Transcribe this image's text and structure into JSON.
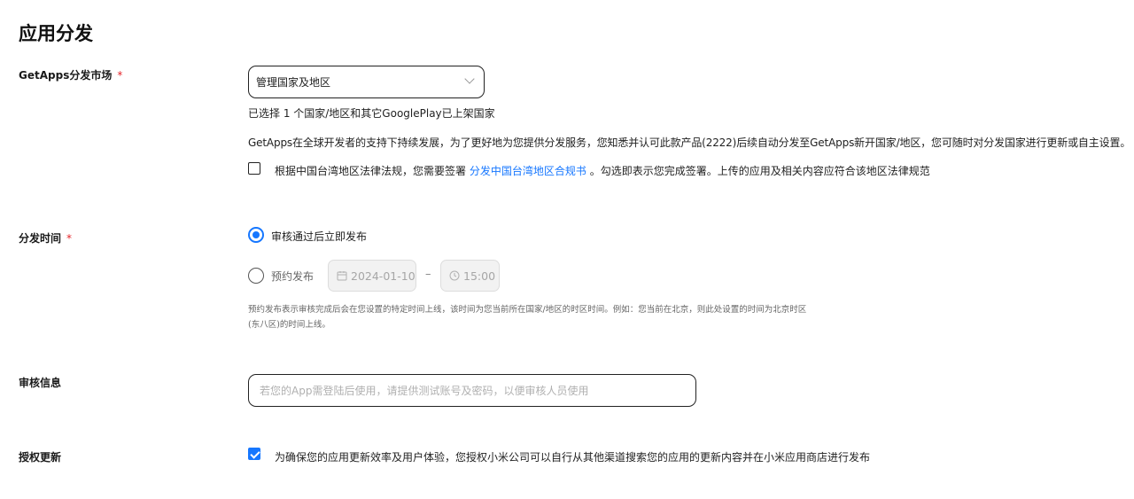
{
  "page": {
    "title": "应用分发"
  },
  "market": {
    "label": "GetApps分发市场",
    "required_mark": "*",
    "select_value": "管理国家及地区",
    "selected_summary": "已选择 1 个国家/地区和其它GooglePlay已上架国家",
    "description": "GetApps在全球开发者的支持下持续发展，为了更好地为您提供分发服务，您知悉并认可此款产品(2222)后续自动分发至GetApps新开国家/地区，您可随时对分发国家进行更新或自主设置。",
    "taiwan_checked": false,
    "taiwan_text_before": "根据中国台湾地区法律法规，您需要签署",
    "taiwan_link": "分发中国台湾地区合规书",
    "taiwan_text_after": "。勾选即表示您完成签署。上传的应用及相关内容应符合该地区法律规范"
  },
  "release_time": {
    "label": "分发时间",
    "required_mark": "*",
    "option_immediate": "审核通过后立即发布",
    "option_scheduled": "预约发布",
    "selected": "immediate",
    "date_value": "2024-01-10",
    "separator": "–",
    "time_value": "15:00",
    "note_line1": "预约发布表示审核完成后会在您设置的特定时间上线，该时间为您当前所在国家/地区的时区时间。例如：您当前在北京，则此处设置的时间为北京时区",
    "note_line2": "(东八区)的时间上线。"
  },
  "review": {
    "label": "审核信息",
    "placeholder": "若您的App需登陆后使用，请提供测试账号及密码，以便审核人员使用",
    "value": ""
  },
  "auth_update": {
    "label": "授权更新",
    "checked": true,
    "text": "为确保您的应用更新效率及用户体验，您授权小米公司可以自行从其他渠道搜索您的应用的更新内容并在小米应用商店进行发布"
  },
  "colors": {
    "accent": "#1677ff",
    "required": "#e5252a",
    "disabled_bg": "#f2f2f2"
  },
  "icons": {
    "select_arrow": "chevron-down-icon",
    "date": "calendar-icon",
    "time": "clock-icon",
    "check": "check-icon"
  }
}
